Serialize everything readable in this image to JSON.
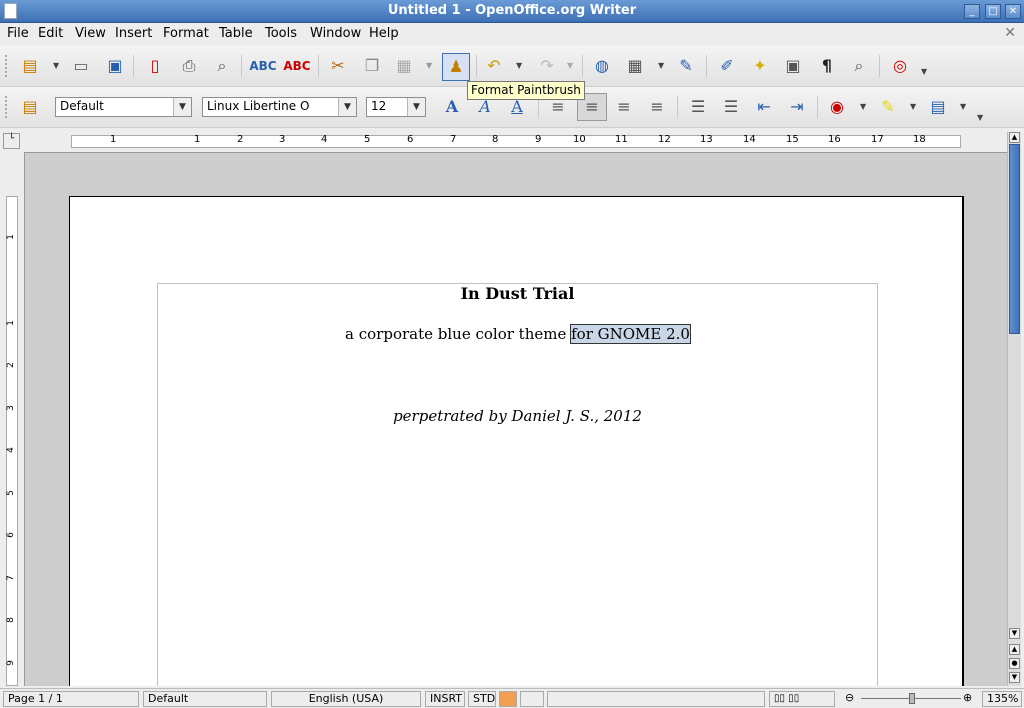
{
  "window": {
    "title": "Untitled 1 - OpenOffice.org Writer"
  },
  "menu": [
    "File",
    "Edit",
    "View",
    "Insert",
    "Format",
    "Table",
    "Tools",
    "Window",
    "Help"
  ],
  "formatting": {
    "paragraph_style": "Default",
    "font_name": "Linux Libertine O",
    "font_size": "12"
  },
  "tooltip": "Format Paintbrush",
  "ruler": {
    "horizontal": [
      "1",
      "1",
      "2",
      "3",
      "4",
      "5",
      "6",
      "7",
      "8",
      "9",
      "10",
      "11",
      "12",
      "13",
      "14",
      "15",
      "16",
      "17",
      "18"
    ],
    "vertical": [
      "1",
      "1",
      "2",
      "3",
      "4",
      "5",
      "6",
      "7",
      "8",
      "9"
    ]
  },
  "document": {
    "title": "In Dust Trial",
    "subtitle_plain": "a corporate blue color theme ",
    "subtitle_selected": "for GNOME 2.0",
    "author": "perpetrated by Daniel J. S., 2012"
  },
  "status": {
    "page": "Page 1 / 1",
    "style": "Default",
    "language": "English (USA)",
    "insert_mode": "INSRT",
    "selection_mode": "STD",
    "zoom": "135%"
  },
  "colors": {
    "titlebar": "#3d6fb4",
    "selection": "#c8d6e8",
    "tooltip": "#ffffcc"
  }
}
